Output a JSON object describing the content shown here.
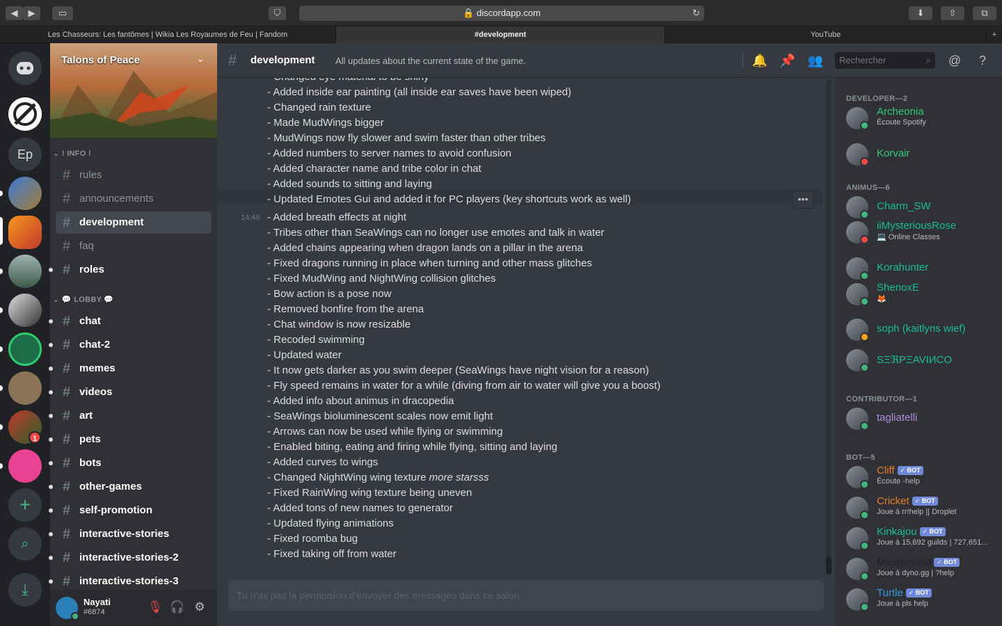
{
  "browser": {
    "url": "discordapp.com",
    "tabs": [
      "Les Chasseurs: Les fantômes | Wikia Les Royaumes de Feu | Fandom",
      "#development",
      "YouTube"
    ]
  },
  "rail": {
    "initials": "Ep",
    "badge": "1"
  },
  "server": {
    "name": "Talons of Peace",
    "categories": {
      "info": "! INFO !",
      "lobby": "💬 LOBBY 💬"
    },
    "channels": [
      "rules",
      "announcements",
      "development",
      "faq",
      "roles",
      "chat",
      "chat-2",
      "memes",
      "videos",
      "art",
      "pets",
      "bots",
      "other-games",
      "self-promotion",
      "interactive-stories",
      "interactive-stories-2",
      "interactive-stories-3"
    ]
  },
  "user": {
    "name": "Nayati",
    "tag": "#6874"
  },
  "channel": {
    "name": "development",
    "topic": "All updates about the current state of the game.",
    "search_placeholder": "Rechercher",
    "compose_placeholder": "Tu n'as pas la permission d'envoyer des messages dans ce salon."
  },
  "messages": {
    "timestamp": "14:48",
    "lines_before": [
      "- Changed eye material to be shiny",
      "- Added inside ear painting (all inside ear saves have been wiped)",
      "- Changed rain texture",
      "- Made MudWings bigger",
      "- MudWings now fly slower and swim faster than other tribes",
      "- Added numbers to server names to avoid confusion",
      "- Added character name and tribe color in chat",
      "- Added sounds to sitting and laying",
      "- Updated Emotes Gui and added it for PC players (key shortcuts work as well)"
    ],
    "lines_after": [
      "- Added breath effects at night",
      "- Tribes other than SeaWings can no longer use emotes and talk in water",
      "- Added chains appearing when dragon lands on a pillar in the arena",
      "- Fixed dragons running in place when turning and other mass glitches",
      "- Fixed MudWing and NightWing collision glitches",
      "- Bow action is a pose now",
      "- Removed bonfire from the arena",
      "- Chat window is now resizable",
      "- Recoded swimming",
      "- Updated water",
      "- It now gets darker as you swim deeper (SeaWings have night vision for a reason)",
      "- Fly speed remains in water for a while (diving from air to water will give you a boost)",
      "- Added info about animus in dracopedia",
      "- SeaWings bioluminescent scales now emit light",
      "- Arrows can now be used while flying or swimming",
      "- Enabled biting, eating and firing while flying, sitting and laying",
      "- Added curves to wings"
    ],
    "italic_line": {
      "prefix": "- Changed NightWing wing texture ",
      "emphasis": "more starsss"
    },
    "lines_end": [
      "- Fixed RainWing wing texture being uneven",
      "- Added tons of new names to generator",
      "- Updated flying animations",
      "- Fixed roomba bug",
      "- Fixed taking off from water"
    ]
  },
  "members": {
    "roles": [
      "DEVELOPER—2",
      "ANIMUS—6",
      "CONTRIBUTOR—1",
      "BOT—5"
    ],
    "bot_label": "BOT",
    "developer": [
      {
        "name": "Archeonia",
        "sub": "Écoute Spotify",
        "color": "#2ecc71",
        "status": "#43b581"
      },
      {
        "name": "Korvair",
        "sub": "",
        "color": "#2ecc71",
        "status": "#f04747"
      }
    ],
    "animus": [
      {
        "name": "Charm_SW",
        "sub": "",
        "color": "#1abc9c",
        "status": "#43b581"
      },
      {
        "name": "iiMysteriousRose",
        "sub": "💻 Online Classes",
        "color": "#1abc9c",
        "status": "#f04747"
      },
      {
        "name": "Korahunter",
        "sub": "",
        "color": "#1abc9c",
        "status": "#43b581"
      },
      {
        "name": "ShenoxE",
        "sub": "🦊",
        "color": "#1abc9c",
        "status": "#43b581"
      },
      {
        "name": "soph (kaitlyns wief)",
        "sub": "",
        "color": "#1abc9c",
        "status": "#faa61a"
      },
      {
        "name": "SΞℜPΞAVIИCO",
        "sub": "",
        "color": "#1abc9c",
        "status": "#43b581"
      }
    ],
    "contributor": [
      {
        "name": "tagliatelli",
        "sub": "",
        "color": "#b38cdf",
        "status": "#43b581"
      }
    ],
    "bots": [
      {
        "name": "Cliff",
        "sub": "Écoute -help",
        "color": "#e67e22",
        "status": "#43b581"
      },
      {
        "name": "Cricket",
        "sub": "Joue à rr!help || Droplet",
        "color": "#e67e22",
        "status": "#43b581"
      },
      {
        "name": "Kinkajou",
        "sub": "Joue à 15,692 guilds | 727,651...",
        "color": "#1abc9c",
        "status": "#43b581"
      },
      {
        "name": "Mastermind",
        "sub": "Joue à dyno.gg | ?help",
        "color": "#20232a",
        "status": "#43b581"
      },
      {
        "name": "Turtle",
        "sub": "Joue à pls help",
        "color": "#3498db",
        "status": "#43b581"
      }
    ]
  }
}
